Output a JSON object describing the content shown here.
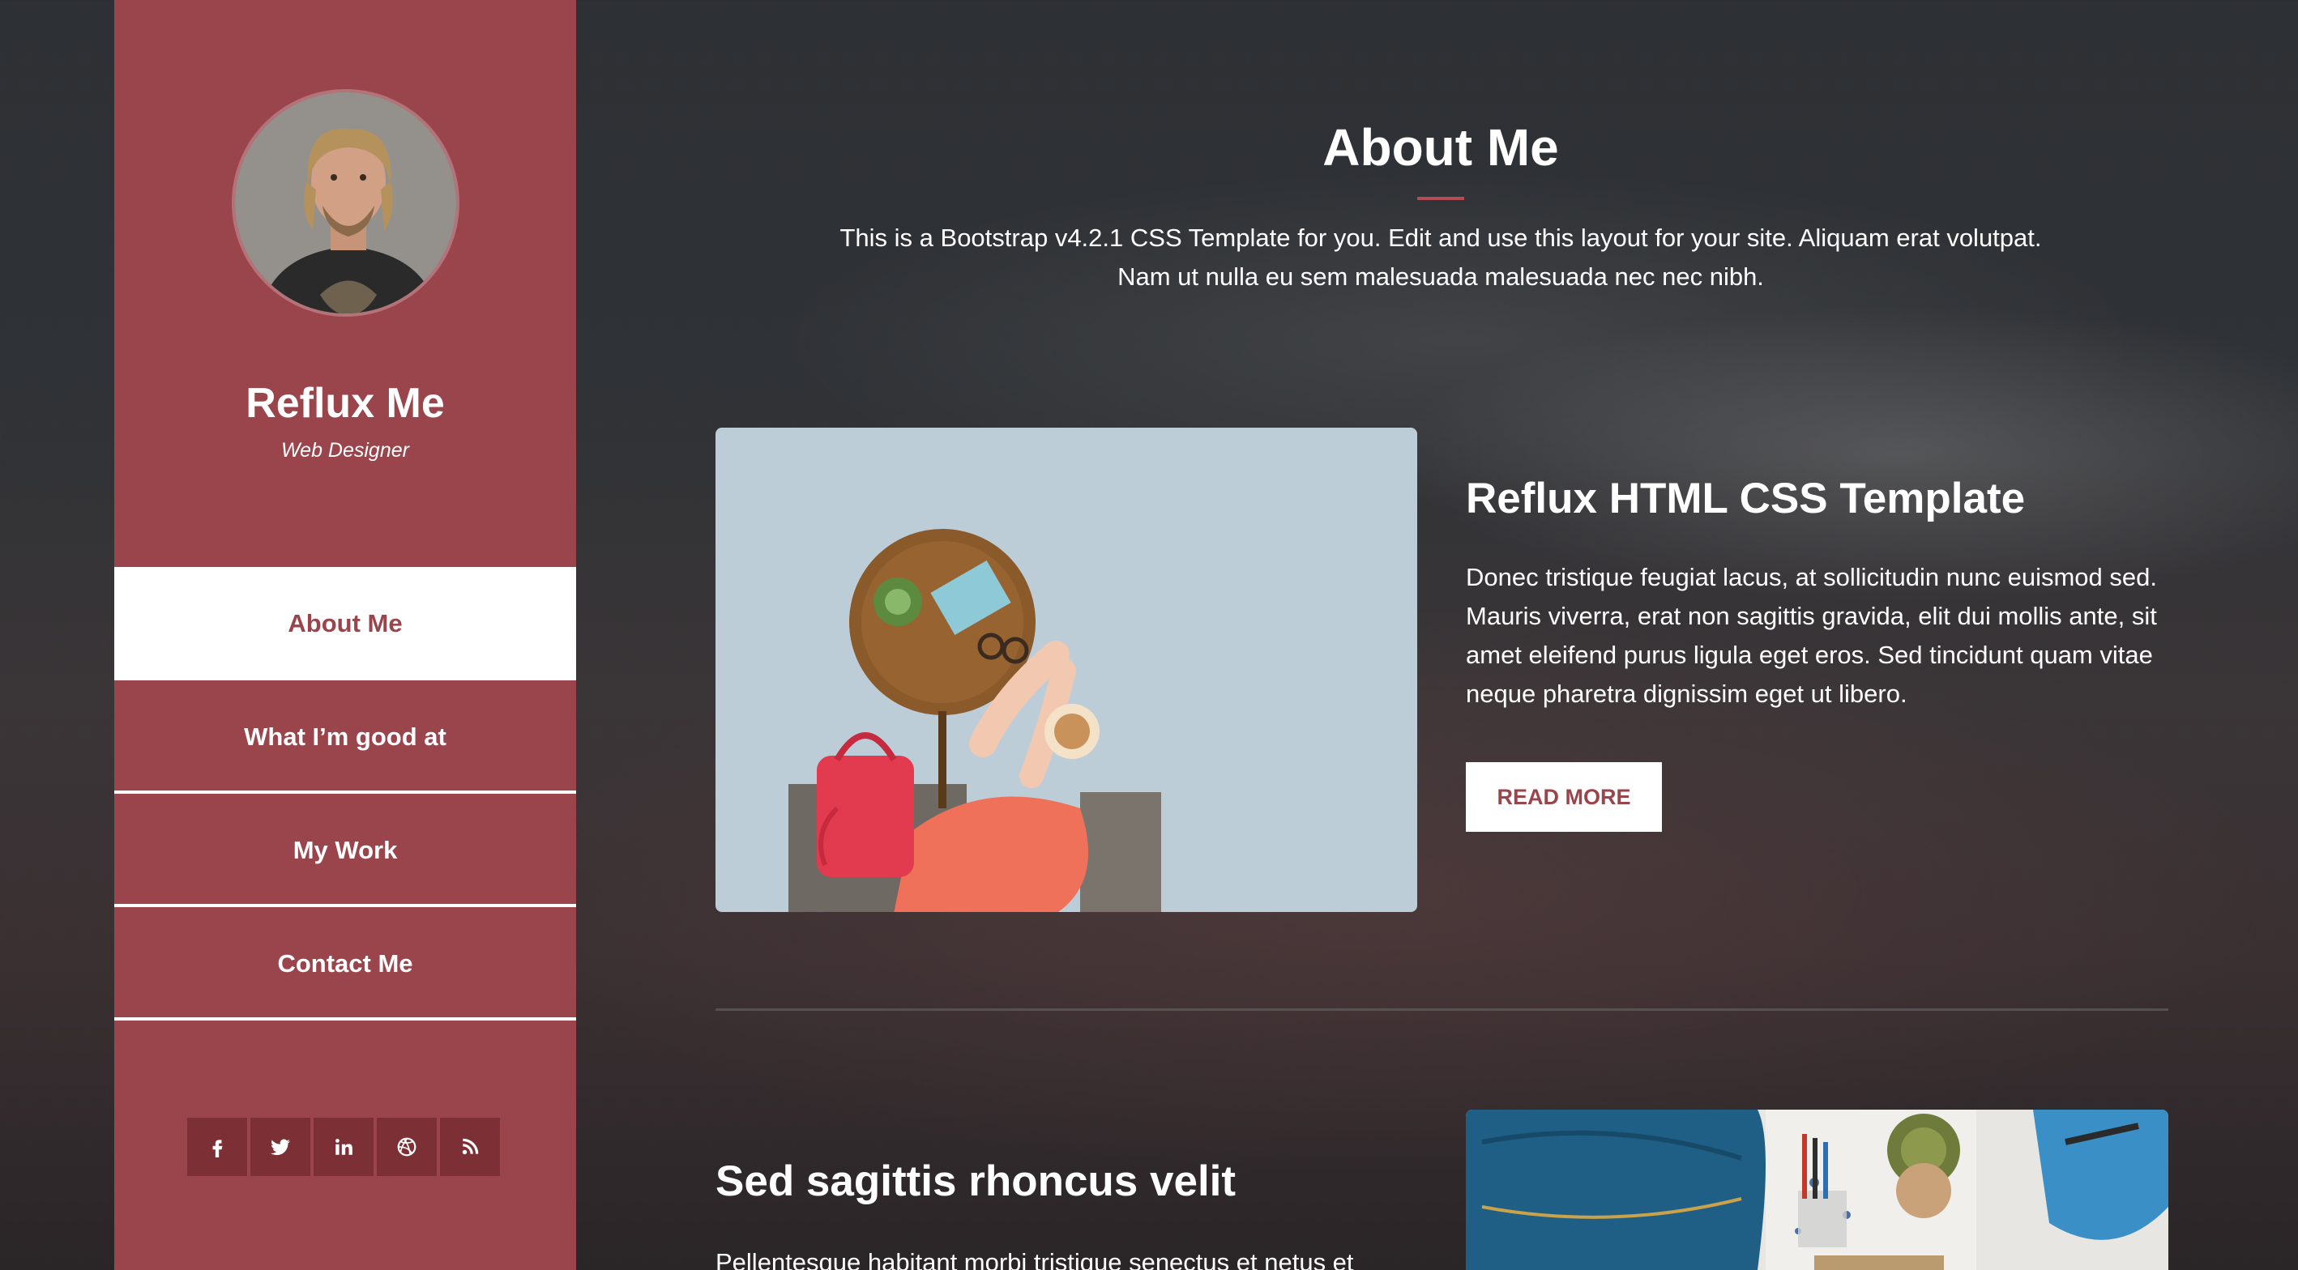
{
  "profile": {
    "name": "Reflux Me",
    "role": "Web Designer",
    "avatar_icon": "person-avatar"
  },
  "nav": {
    "items": [
      {
        "label": "About Me",
        "active": true
      },
      {
        "label": "What I’m good at",
        "active": false
      },
      {
        "label": "My Work",
        "active": false
      },
      {
        "label": "Contact Me",
        "active": false
      }
    ]
  },
  "social": {
    "icons": [
      "facebook-icon",
      "twitter-icon",
      "linkedin-icon",
      "dribbble-icon",
      "rss-icon"
    ]
  },
  "main": {
    "title": "About Me",
    "intro_line1": "This is a Bootstrap v4.2.1 CSS Template for you. Edit and use this layout for your site. Aliquam erat volutpat.",
    "intro_line2": "Nam ut nulla eu sem malesuada malesuada nec nec nibh.",
    "feature": {
      "title": "Reflux HTML CSS Template",
      "text_lines": [
        "Donec tristique feugiat lacus, at sollicitudin nunc euismod sed.",
        "Mauris viverra, erat non sagittis gravida, elit dui mollis ante, sit",
        "amet eleifend purus ligula eget eros. Sed tincidunt quam vitae",
        "neque pharetra dignissim eget ut libero."
      ],
      "button": "READ MORE"
    },
    "second": {
      "title": "Sed sagittis rhoncus velit",
      "text": "Pellentesque habitant morbi tristique senectus et netus et"
    }
  },
  "colors": {
    "accent": "#9a444c",
    "accent_dark": "#7d2f36",
    "background": "#2f3236"
  }
}
